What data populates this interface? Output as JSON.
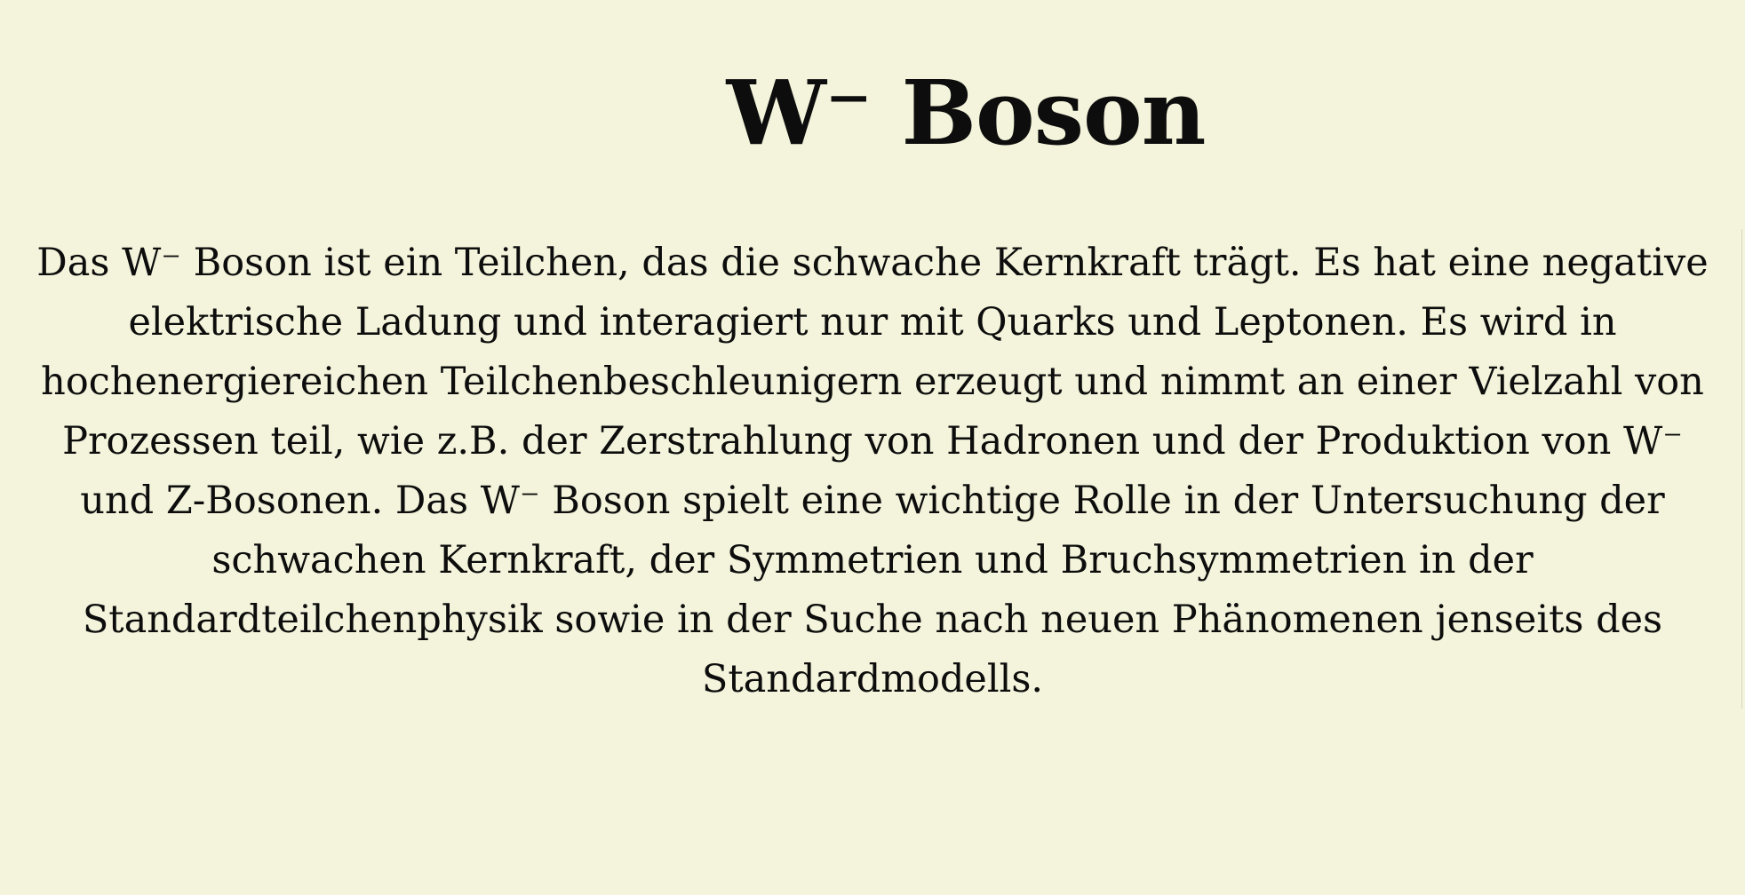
{
  "page": {
    "title": "W⁻ Boson",
    "paragraph": "Das W⁻ Boson ist ein Teilchen, das die schwache Kernkraft trägt. Es hat eine negative elektrische Ladung und interagiert nur mit Quarks und Leptonen. Es wird in hochenergiereichen Teilchenbeschleunigern erzeugt und nimmt an einer Vielzahl von Prozessen teil, wie z.B. der Zerstrahlung von Hadronen und der Produktion von W⁻ und Z-Bosonen. Das W⁻ Boson spielt eine wichtige Rolle in der Untersuchung der schwachen Kernkraft, der Symmetrien und Bruchsymmetrien in der Standardteilchenphysik sowie in der Suche nach neuen Phänomenen jenseits des Standardmodells."
  },
  "colors": {
    "background": "#f4f4dc",
    "text": "#0d0d0d"
  }
}
